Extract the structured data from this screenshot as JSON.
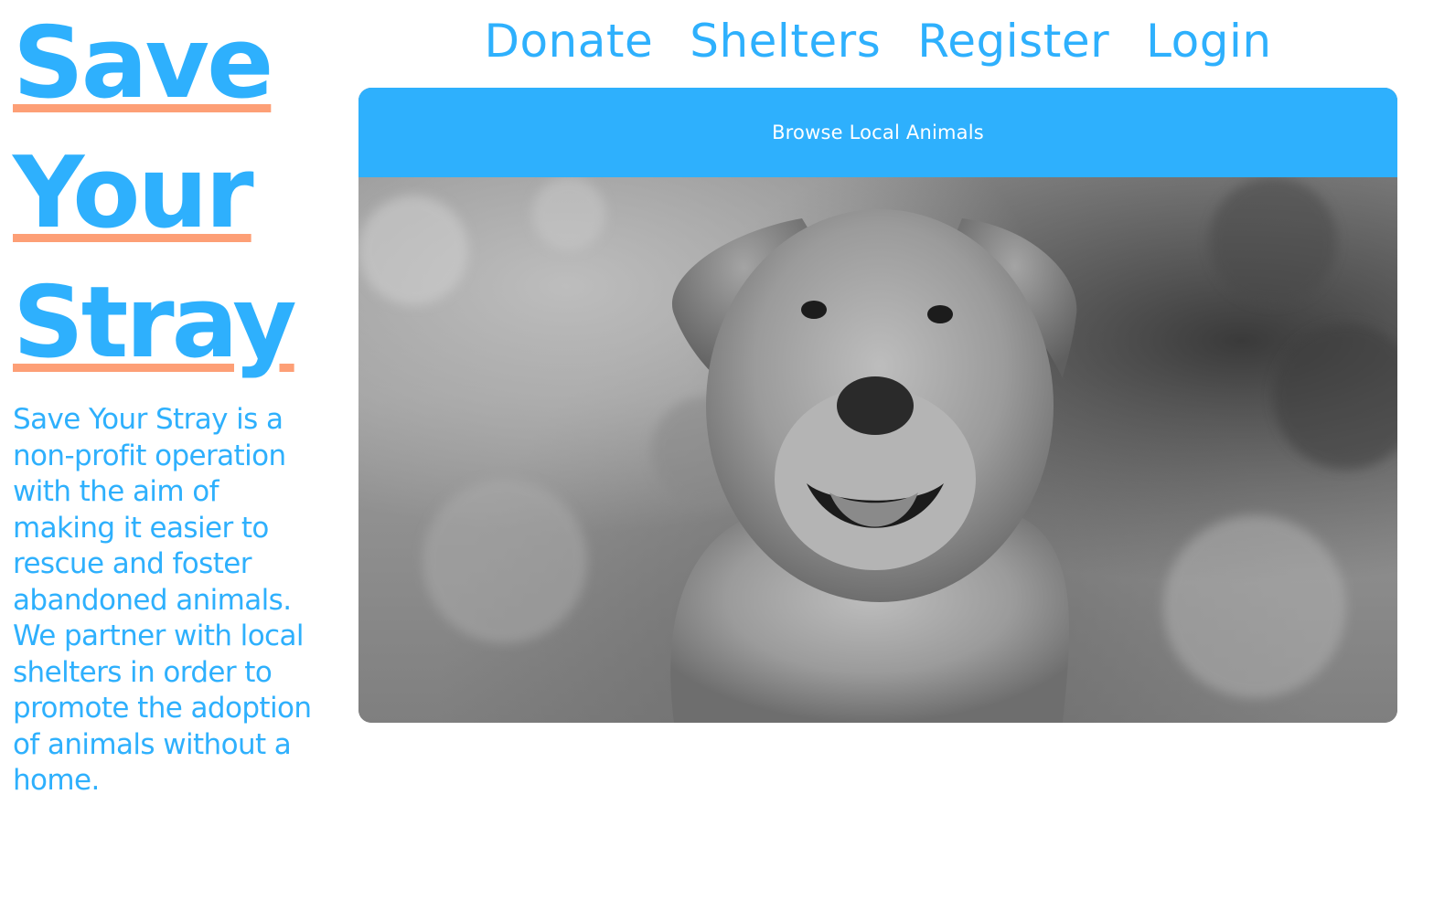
{
  "brand": {
    "lines": [
      "Save",
      "Your",
      "Stray"
    ]
  },
  "about": {
    "text": "Save Your Stray is a non-profit operation with the aim of making it easier to rescue and foster abandoned animals. We partner with local shelters in order to promote the adoption of animals without a home."
  },
  "nav": {
    "items": [
      {
        "label": "Donate"
      },
      {
        "label": "Shelters"
      },
      {
        "label": "Register"
      },
      {
        "label": "Login"
      }
    ]
  },
  "card": {
    "header_label": "Browse Local Animals",
    "photo_alt": "dog-photo"
  },
  "colors": {
    "accent": "#2eb0fd",
    "underline": "#fd9f76",
    "background": "#ffffff"
  }
}
